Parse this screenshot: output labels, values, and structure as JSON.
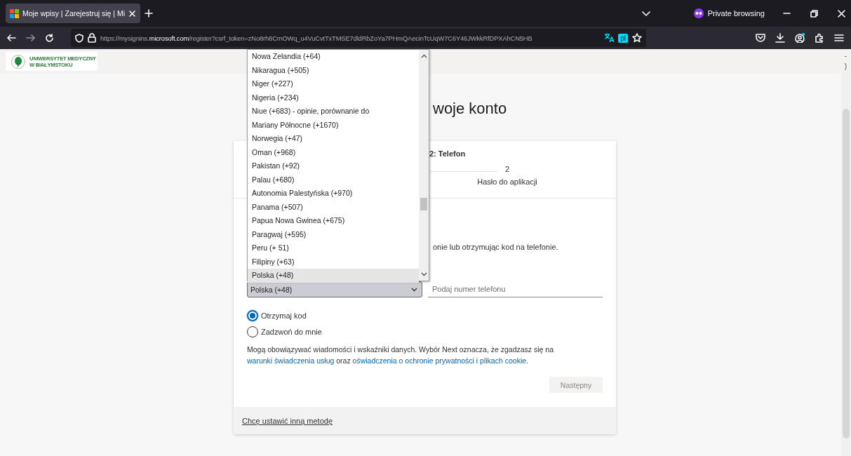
{
  "browser": {
    "tab_title": "Moje wpisy | Zarejestruj się | Mi",
    "private_label": "Private browsing",
    "url": "https://mysignins.**microsoft.com**/register?csrf_token=zNo8rh8CmOWq_u4VuCvtTxTMSE7dldRbZoYa7PHmQAecinTcUqW7C6Y46JWkkRfDPXAhCN5HB",
    "translate_badge": "pl"
  },
  "header": {
    "logo_lines": [
      "UNIWERSYTET MEDYCZNY",
      "W BIAŁYMSTOKU"
    ]
  },
  "page": {
    "title": "woje konto",
    "edge_marks": [
      "-",
      ")"
    ]
  },
  "card": {
    "step_title": "2: Telefon",
    "steps": [
      {
        "number": "2",
        "label": "Hasło do aplikacji"
      }
    ],
    "description": "onie lub otrzymując kod na telefonie.",
    "country_select": {
      "value": "Polska (+48)",
      "expanded": true
    },
    "phone_field": {
      "placeholder": "Podaj numer telefonu"
    },
    "options": [
      {
        "label": "Otrzymaj kod",
        "selected": true
      },
      {
        "label": "Zadzwoń do mnie",
        "selected": false
      }
    ],
    "legal_text": [
      {
        "kind": "text",
        "text": "Mogą obowiązywać wiadomości i wskaźniki danych. Wybór Next oznacza, że zgadzasz się na "
      },
      {
        "kind": "link",
        "text": "warunki świadczenia usług"
      },
      {
        "kind": "text",
        "text": " oraz "
      },
      {
        "kind": "link",
        "text": "oświadczenia o ochronie prywatności i plikach cookie."
      }
    ],
    "next_button": {
      "label": "Następny",
      "disabled": true
    },
    "footer_link": "Chcę ustawić inną metodę"
  },
  "dropdown": {
    "items": [
      {
        "label": "Nowa Zelandia (+64)",
        "selected": false
      },
      {
        "label": "Nikaragua (+505)",
        "selected": false
      },
      {
        "label": "Niger (+227)",
        "selected": false
      },
      {
        "label": "Nigeria (+234)",
        "selected": false
      },
      {
        "label": "Niue (+683) - opinie, porównanie do",
        "selected": false
      },
      {
        "label": "Mariany Północne (+1670)",
        "selected": false
      },
      {
        "label": "Norwegia (+47)",
        "selected": false
      },
      {
        "label": "Oman (+968)",
        "selected": false
      },
      {
        "label": "Pakistan (+92)",
        "selected": false
      },
      {
        "label": "Palau (+680)",
        "selected": false
      },
      {
        "label": "Autonomia Palestyńska (+970)",
        "selected": false
      },
      {
        "label": "Panama (+507)",
        "selected": false
      },
      {
        "label": "Papua Nowa Gwinea (+675)",
        "selected": false
      },
      {
        "label": "Paragwaj (+595)",
        "selected": false
      },
      {
        "label": "Peru (+ 51)",
        "selected": false
      },
      {
        "label": "Filipiny (+63)",
        "selected": false
      },
      {
        "label": "Polska (+48)",
        "selected": true
      }
    ]
  }
}
